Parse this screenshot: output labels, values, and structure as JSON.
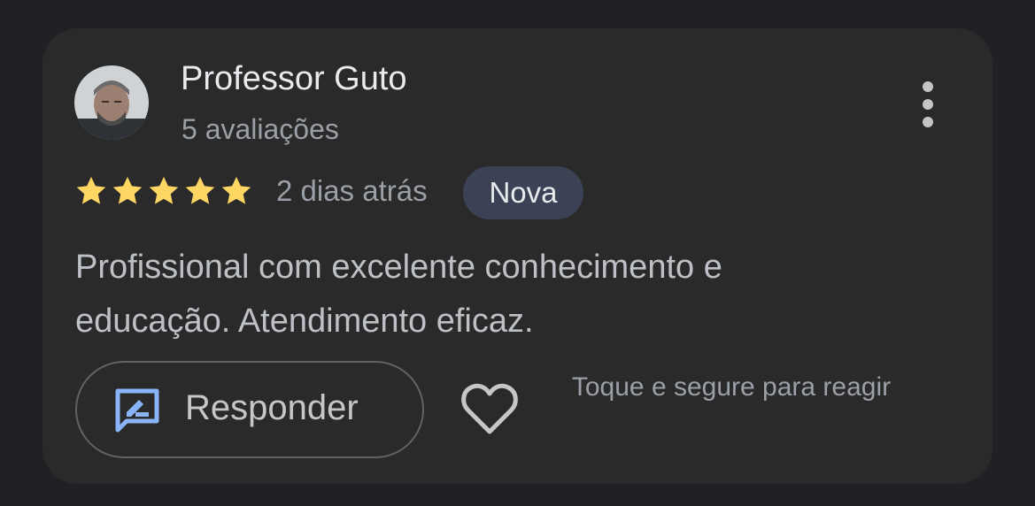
{
  "review": {
    "author_name": "Professor Guto",
    "author_reviews": "5 avaliações",
    "rating": 5,
    "rating_max": 5,
    "date": "2 dias atrás",
    "badge": "Nova",
    "text": "Profissional com excelente conhecimento e educação. Atendimento eficaz."
  },
  "actions": {
    "reply_label": "Responder",
    "react_hint": "Toque e segure para reagir"
  },
  "colors": {
    "star": "#fdd663",
    "reply_icon": "#8ab4f8",
    "badge_bg": "#3b4255"
  },
  "icons": {
    "menu": "more-vert-icon",
    "reply": "rate-review-icon",
    "like": "heart-outline-icon"
  }
}
